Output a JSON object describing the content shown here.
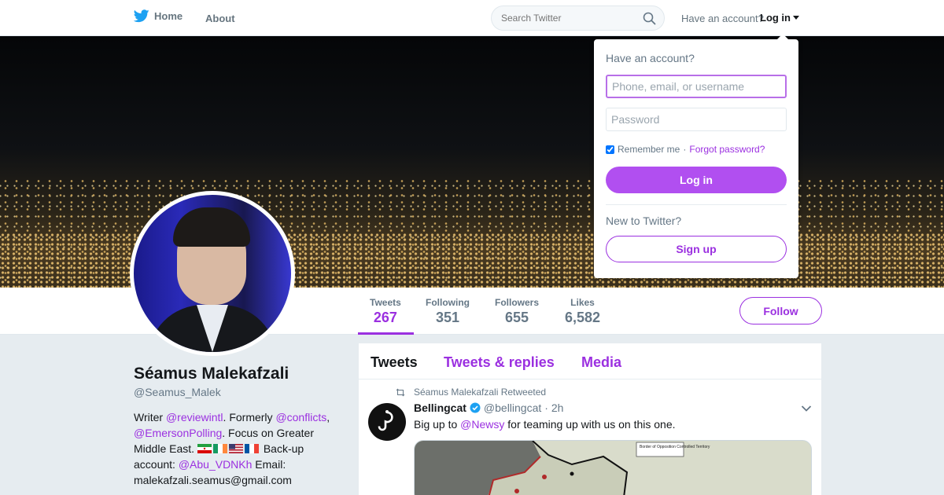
{
  "colors": {
    "accent": "#9b30e0",
    "twitter_blue": "#1da1f2",
    "login_button": "#b14ff0"
  },
  "nav": {
    "home_label": "Home",
    "about_label": "About",
    "search_placeholder": "Search Twitter",
    "have_account": "Have an account?",
    "login_label": "Log in"
  },
  "stats": [
    {
      "label": "Tweets",
      "value": "267",
      "active": true
    },
    {
      "label": "Following",
      "value": "351",
      "active": false
    },
    {
      "label": "Followers",
      "value": "655",
      "active": false
    },
    {
      "label": "Likes",
      "value": "6,582",
      "active": false
    }
  ],
  "follow_label": "Follow",
  "profile": {
    "name": "Séamus Malekafzali",
    "handle": "@Seamus_Malek",
    "bio": {
      "t1": "Writer ",
      "l1": "@reviewintl",
      "t2": ". Formerly ",
      "l2": "@conflicts",
      "t3": ", ",
      "l3": "@EmersonPolling",
      "t4": ". Focus on Greater Middle East. ",
      "t5": " Back-up account: ",
      "l4": "@Abu_VDNKh",
      "t6": " Email: malekafzali.seamus@gmail.com"
    }
  },
  "timeline": {
    "tabs": [
      "Tweets",
      "Tweets & replies",
      "Media"
    ],
    "retweet_label": "Séamus Malekafzali Retweeted",
    "tweet": {
      "author": "Bellingcat",
      "handle": "@bellingcat",
      "time": "· 2h",
      "text_before": "Big up to ",
      "mention": "@Newsy",
      "text_after": " for teaming up with us on this one.",
      "map_label": "Border of Opposition Controlled Territory"
    }
  },
  "login_dropdown": {
    "title": "Have an account?",
    "username_placeholder": "Phone, email, or username",
    "password_placeholder": "Password",
    "remember_me": "Remember me",
    "separator": "·",
    "forgot_password": "Forgot password?",
    "login_button": "Log in",
    "new_to_twitter": "New to Twitter?",
    "signup_button": "Sign up"
  }
}
